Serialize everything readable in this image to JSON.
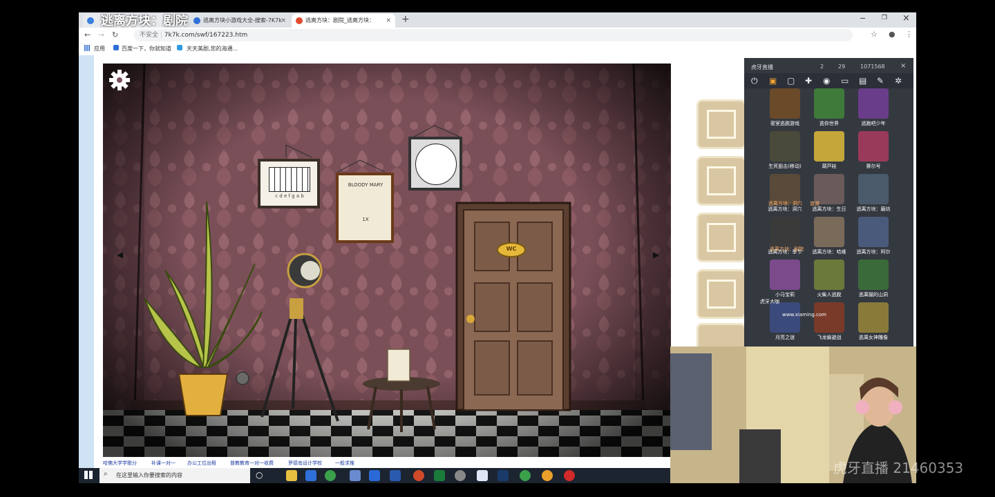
{
  "video_title": "逃离方块：剧院",
  "browser": {
    "tabs": [
      {
        "label": "逃离方块：剧院"
      },
      {
        "label": "逃离方块小游戏大全-搜索-7K7k",
        "close": "×"
      },
      {
        "label": "逃离方块：剧院_逃离方块：",
        "close": "×"
      }
    ],
    "new_tab": "+",
    "window_controls": {
      "minimize": "−",
      "maximize": "❐",
      "close": "×"
    },
    "security_label": "不安全",
    "url": "7k7k.com/swf/167223.htm",
    "bookmarks": [
      "应用",
      "百度一下，你就知道",
      "天天美剧,您的海通..."
    ],
    "footer_links": [
      "哈佛大学学歌分",
      "补课一对一",
      "办公工位出租",
      "普教教育一对一收费",
      "罗德岛设计学校",
      "一般求推"
    ]
  },
  "game": {
    "door_sign": "WC",
    "poster_text": "BLOODY MARY",
    "poster_sub": "1X",
    "piano_letters": "c d e f g a b",
    "left_arrow": "◀",
    "right_arrow": "▶",
    "inventory_slots": 5
  },
  "taskbar": {
    "search_placeholder": "在这里输入你要搜索的内容"
  },
  "overlay": {
    "brand": "虎牙直播",
    "stats": [
      "2",
      "29",
      "1071568"
    ],
    "thumbnails": [
      {
        "label": "密室逃脱游戏",
        "color": "#6b4a2a"
      },
      {
        "label": "逃你世界",
        "color": "#3f7a3a"
      },
      {
        "label": "逃跑吧少年",
        "color": "#6a3d8a"
      },
      {
        "label": "生死狙击(移动)",
        "color": "#4a4a3a"
      },
      {
        "label": "葫芦娃",
        "color": "#c4a63a"
      },
      {
        "label": "赛尔号",
        "color": "#9a3a5a"
      },
      {
        "label": "逃离方块：洞穴",
        "color": "#5a4a3a"
      },
      {
        "label": "逃离方块：生日",
        "color": "#6a5a5a"
      },
      {
        "label": "逃离方块：磨坊",
        "color": "#4a5a6a"
      },
      {
        "label": "逃离方块：季节",
        "color": "#3a3a3a"
      },
      {
        "label": "逃离方块：哈维",
        "color": "#7a6a5a"
      },
      {
        "label": "逃离方块：阿尔",
        "color": "#4a5a7a"
      },
      {
        "label": "小马宝莉",
        "color": "#7a4a8a"
      },
      {
        "label": "火柴人逃脱",
        "color": "#6a7a3a"
      },
      {
        "label": "逃离猫的山洞",
        "color": "#3a6a3a"
      },
      {
        "label": "月亮之谜",
        "color": "#3a4a7a"
      },
      {
        "label": "飞龙躲避战",
        "color": "#7a3a2a"
      },
      {
        "label": "逃离女神雕像",
        "color": "#8a7a3a"
      }
    ],
    "chat": [
      "逃离方块：洞穴",
      "渡渡",
      "逃离方块：剧院",
      "虎牙大咖"
    ],
    "url_snippet": "www.xiaming.com"
  },
  "watermark": "虎牙直播 21460353"
}
